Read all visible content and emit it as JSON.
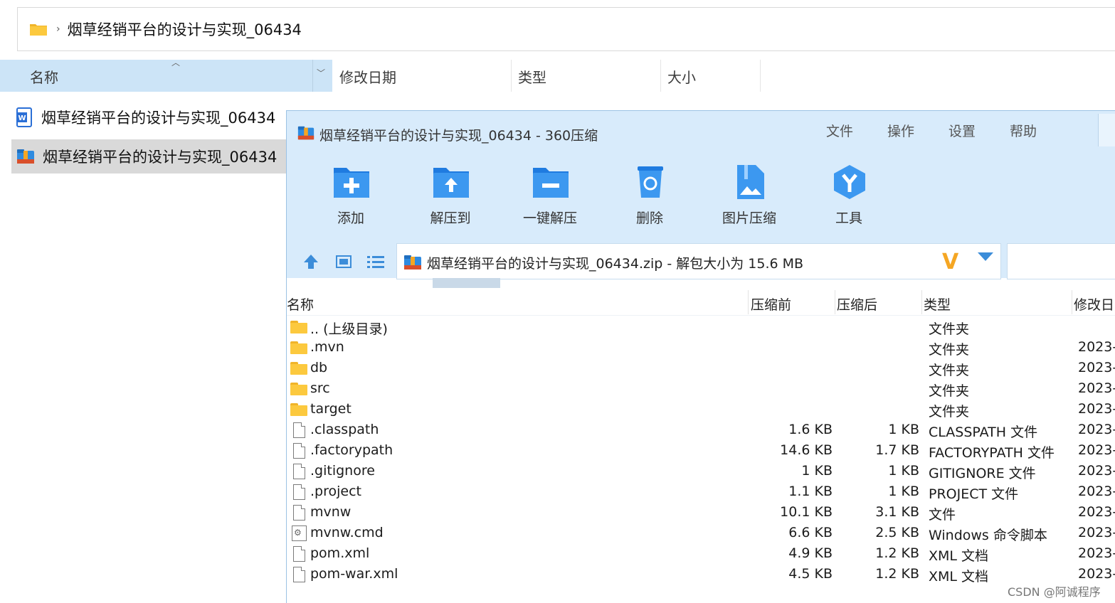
{
  "explorer": {
    "breadcrumb": "烟草经销平台的设计与实现_06434",
    "columns": {
      "name": "名称",
      "modified": "修改日期",
      "type": "类型",
      "size": "大小"
    },
    "rows": [
      {
        "label": "烟草经销平台的设计与实现_06434",
        "icon": "word-doc-icon"
      },
      {
        "label": "烟草经销平台的设计与实现_06434",
        "icon": "zip-archive-icon"
      }
    ]
  },
  "zip": {
    "title": "烟草经销平台的设计与实现_06434 - 360压缩",
    "menu": [
      "文件",
      "操作",
      "设置",
      "帮助"
    ],
    "tools": [
      {
        "label": "添加",
        "icon": "add-folder-icon"
      },
      {
        "label": "解压到",
        "icon": "extract-to-icon"
      },
      {
        "label": "一键解压",
        "icon": "one-click-extract-icon"
      },
      {
        "label": "删除",
        "icon": "delete-icon"
      },
      {
        "label": "图片压缩",
        "icon": "image-compress-icon"
      },
      {
        "label": "工具",
        "icon": "tools-icon"
      }
    ],
    "path": "烟草经销平台的设计与实现_06434.zip - 解包大小为 15.6 MB",
    "headers": {
      "name": "名称",
      "before": "压缩前",
      "after": "压缩后",
      "type": "类型",
      "date": "修改日"
    },
    "files": [
      {
        "name": ".. (上级目录)",
        "before": "",
        "after": "",
        "type": "文件夹",
        "date": "",
        "icon": "folder"
      },
      {
        "name": ".mvn",
        "before": "",
        "after": "",
        "type": "文件夹",
        "date": "2023-",
        "icon": "folder"
      },
      {
        "name": "db",
        "before": "",
        "after": "",
        "type": "文件夹",
        "date": "2023-",
        "icon": "folder"
      },
      {
        "name": "src",
        "before": "",
        "after": "",
        "type": "文件夹",
        "date": "2023-",
        "icon": "folder"
      },
      {
        "name": "target",
        "before": "",
        "after": "",
        "type": "文件夹",
        "date": "2023-",
        "icon": "folder"
      },
      {
        "name": ".classpath",
        "before": "1.6 KB",
        "after": "1 KB",
        "type": "CLASSPATH 文件",
        "date": "2023-",
        "icon": "file"
      },
      {
        "name": ".factorypath",
        "before": "14.6 KB",
        "after": "1.7 KB",
        "type": "FACTORYPATH 文件",
        "date": "2023-",
        "icon": "file"
      },
      {
        "name": ".gitignore",
        "before": "1 KB",
        "after": "1 KB",
        "type": "GITIGNORE 文件",
        "date": "2023-",
        "icon": "file"
      },
      {
        "name": ".project",
        "before": "1.1 KB",
        "after": "1 KB",
        "type": "PROJECT 文件",
        "date": "2023-",
        "icon": "file"
      },
      {
        "name": "mvnw",
        "before": "10.1 KB",
        "after": "3.1 KB",
        "type": "文件",
        "date": "2023-",
        "icon": "file"
      },
      {
        "name": "mvnw.cmd",
        "before": "6.6 KB",
        "after": "2.5 KB",
        "type": "Windows 命令脚本",
        "date": "2023-",
        "icon": "cmd"
      },
      {
        "name": "pom.xml",
        "before": "4.9 KB",
        "after": "1.2 KB",
        "type": "XML 文档",
        "date": "2023-",
        "icon": "file"
      },
      {
        "name": "pom-war.xml",
        "before": "4.5 KB",
        "after": "1.2 KB",
        "type": "XML 文档",
        "date": "2023-",
        "icon": "file"
      }
    ]
  },
  "watermark": "CSDN @阿诚程序",
  "colors": {
    "accent": "#2f8be0",
    "header_bg": "#d8ebfb",
    "selected": "#d9d9d9",
    "folder": "#fcc93e"
  }
}
